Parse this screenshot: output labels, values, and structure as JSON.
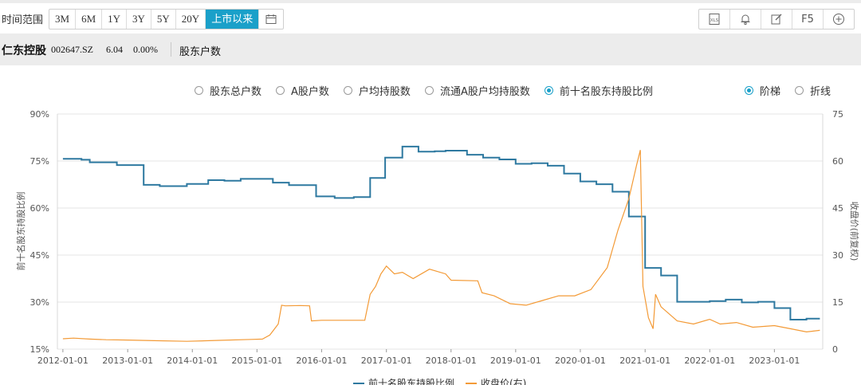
{
  "toolbar": {
    "range_label": "时间范围",
    "ranges": [
      "3M",
      "6M",
      "1Y",
      "3Y",
      "5Y",
      "20Y",
      "上市以来"
    ],
    "active_range": "上市以来",
    "tools": [
      "xls-icon",
      "bell-icon",
      "edit-icon",
      "F5",
      "plus-circle-icon"
    ],
    "f5_label": "F5"
  },
  "stock": {
    "name": "仁东控股",
    "code": "002647.SZ",
    "price": "6.04",
    "change": "0.00%",
    "section": "股东户数"
  },
  "options": {
    "metrics": [
      "股东总户数",
      "A股户数",
      "户均持股数",
      "流通A股户均持股数",
      "前十名股东持股比例"
    ],
    "selected_metric": "前十名股东持股比例",
    "styles": [
      "阶梯",
      "折线"
    ],
    "selected_style": "阶梯"
  },
  "colors": {
    "step_line": "#2e79a0",
    "price_line": "#f39a36",
    "accent": "#1aa0c9"
  },
  "chart_data": {
    "type": "line",
    "ylabel_left": "前十名股东持股比例",
    "ylabel_right": "收盘价(前复权)",
    "y_left_ticks": [
      "15%",
      "30%",
      "45%",
      "60%",
      "75%",
      "90%"
    ],
    "y_right_ticks": [
      "0",
      "15",
      "30",
      "45",
      "60",
      "75"
    ],
    "x_ticks": [
      "2012-01-01",
      "2013-01-01",
      "2014-01-01",
      "2015-01-01",
      "2016-01-01",
      "2017-01-01",
      "2018-01-01",
      "2019-01-01",
      "2020-01-01",
      "2021-01-01",
      "2022-01-01",
      "2023-01-01"
    ],
    "y_left_range": [
      15,
      90
    ],
    "y_right_range": [
      0,
      75
    ],
    "x_range": [
      "2011-12-01",
      "2023-10-01"
    ],
    "grid": true,
    "legend": [
      "前十名股东持股比例",
      "收盘价(右)"
    ],
    "legend_position": "bottom",
    "series": [
      {
        "name": "前十名股东持股比例",
        "style": "step",
        "axis": "left",
        "points": [
          [
            "2012-01-01",
            75.7
          ],
          [
            "2012-04-15",
            75.4
          ],
          [
            "2012-06-01",
            74.6
          ],
          [
            "2012-09-01",
            74.6
          ],
          [
            "2012-11-01",
            73.7
          ],
          [
            "2013-04-01",
            67.4
          ],
          [
            "2013-07-01",
            67.0
          ],
          [
            "2013-12-01",
            67.7
          ],
          [
            "2014-01-01",
            67.7
          ],
          [
            "2014-04-01",
            68.9
          ],
          [
            "2014-07-01",
            68.7
          ],
          [
            "2014-10-01",
            69.3
          ],
          [
            "2015-01-01",
            69.3
          ],
          [
            "2015-04-01",
            68.1
          ],
          [
            "2015-07-01",
            67.3
          ],
          [
            "2015-12-01",
            63.7
          ],
          [
            "2016-03-15",
            63.2
          ],
          [
            "2016-07-01",
            63.5
          ],
          [
            "2016-10-01",
            69.6
          ],
          [
            "2016-12-25",
            76.1
          ],
          [
            "2017-04-01",
            79.6
          ],
          [
            "2017-07-01",
            78.0
          ],
          [
            "2017-10-01",
            78.1
          ],
          [
            "2017-12-01",
            78.3
          ],
          [
            "2018-04-01",
            77.0
          ],
          [
            "2018-07-01",
            76.1
          ],
          [
            "2018-10-01",
            75.5
          ],
          [
            "2019-01-01",
            74.1
          ],
          [
            "2019-04-01",
            74.3
          ],
          [
            "2019-07-01",
            73.5
          ],
          [
            "2019-10-01",
            71.0
          ],
          [
            "2020-01-01",
            68.5
          ],
          [
            "2020-04-01",
            67.6
          ],
          [
            "2020-07-01",
            65.2
          ],
          [
            "2020-10-01",
            57.3
          ],
          [
            "2021-01-01",
            40.9
          ],
          [
            "2021-04-01",
            38.5
          ],
          [
            "2021-07-01",
            30.1
          ],
          [
            "2022-01-01",
            30.3
          ],
          [
            "2022-04-01",
            30.8
          ],
          [
            "2022-07-01",
            29.9
          ],
          [
            "2022-10-01",
            30.1
          ],
          [
            "2023-01-01",
            28.1
          ],
          [
            "2023-04-01",
            24.4
          ],
          [
            "2023-07-01",
            24.7
          ],
          [
            "2023-09-15",
            24.7
          ]
        ]
      },
      {
        "name": "收盘价(右)",
        "style": "line",
        "axis": "right",
        "points": [
          [
            "2012-01-01",
            3.3
          ],
          [
            "2012-03-01",
            3.5
          ],
          [
            "2012-06-01",
            3.2
          ],
          [
            "2012-09-01",
            3.0
          ],
          [
            "2013-01-01",
            2.9
          ],
          [
            "2013-06-01",
            2.7
          ],
          [
            "2013-12-01",
            2.5
          ],
          [
            "2014-06-01",
            2.8
          ],
          [
            "2014-12-01",
            3.1
          ],
          [
            "2015-02-01",
            3.2
          ],
          [
            "2015-03-15",
            4.5
          ],
          [
            "2015-05-01",
            8.0
          ],
          [
            "2015-05-20",
            14.0
          ],
          [
            "2015-06-10",
            13.8
          ],
          [
            "2015-09-01",
            13.9
          ],
          [
            "2015-10-25",
            13.8
          ],
          [
            "2015-11-05",
            9.0
          ],
          [
            "2016-01-01",
            9.2
          ],
          [
            "2016-09-01",
            9.2
          ],
          [
            "2016-10-01",
            17.5
          ],
          [
            "2016-11-01",
            20.0
          ],
          [
            "2016-12-01",
            24.0
          ],
          [
            "2017-01-01",
            26.5
          ],
          [
            "2017-02-15",
            24.0
          ],
          [
            "2017-04-01",
            24.5
          ],
          [
            "2017-06-01",
            22.5
          ],
          [
            "2017-09-01",
            25.5
          ],
          [
            "2017-12-01",
            24.0
          ],
          [
            "2018-01-01",
            22.0
          ],
          [
            "2018-06-01",
            21.8
          ],
          [
            "2018-06-25",
            18.0
          ],
          [
            "2018-09-01",
            17.0
          ],
          [
            "2018-12-01",
            14.5
          ],
          [
            "2019-03-01",
            14.0
          ],
          [
            "2019-06-01",
            15.5
          ],
          [
            "2019-09-01",
            17.0
          ],
          [
            "2019-12-01",
            17.0
          ],
          [
            "2020-03-01",
            19.0
          ],
          [
            "2020-06-01",
            26.0
          ],
          [
            "2020-08-01",
            38.0
          ],
          [
            "2020-10-01",
            48.0
          ],
          [
            "2020-11-15",
            59.0
          ],
          [
            "2020-12-05",
            63.5
          ],
          [
            "2020-12-20",
            20.0
          ],
          [
            "2021-01-20",
            10.0
          ],
          [
            "2021-02-15",
            6.5
          ],
          [
            "2021-03-01",
            17.5
          ],
          [
            "2021-04-01",
            13.5
          ],
          [
            "2021-07-01",
            9.0
          ],
          [
            "2021-10-01",
            8.0
          ],
          [
            "2022-01-01",
            9.5
          ],
          [
            "2022-03-01",
            8.0
          ],
          [
            "2022-06-01",
            8.5
          ],
          [
            "2022-09-01",
            7.0
          ],
          [
            "2023-01-01",
            7.5
          ],
          [
            "2023-04-01",
            6.5
          ],
          [
            "2023-07-01",
            5.5
          ],
          [
            "2023-09-15",
            6.0
          ]
        ]
      }
    ]
  }
}
